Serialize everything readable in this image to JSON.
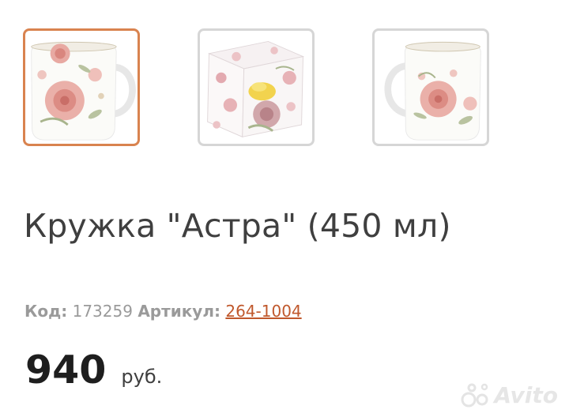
{
  "gallery": {
    "thumbnails": [
      {
        "subject": "mug-front",
        "selected": true
      },
      {
        "subject": "gift-box",
        "selected": false
      },
      {
        "subject": "mug-back",
        "selected": false
      }
    ],
    "accent_color": "#d9834f"
  },
  "product": {
    "title": "Кружка \"Астра\" (450 мл)",
    "code_label": "Код:",
    "code_value": "173259",
    "article_label": "Артикул:",
    "article_value": "264-1004",
    "price_value": "940",
    "price_currency": "руб."
  },
  "watermark": {
    "text": "Avito"
  }
}
